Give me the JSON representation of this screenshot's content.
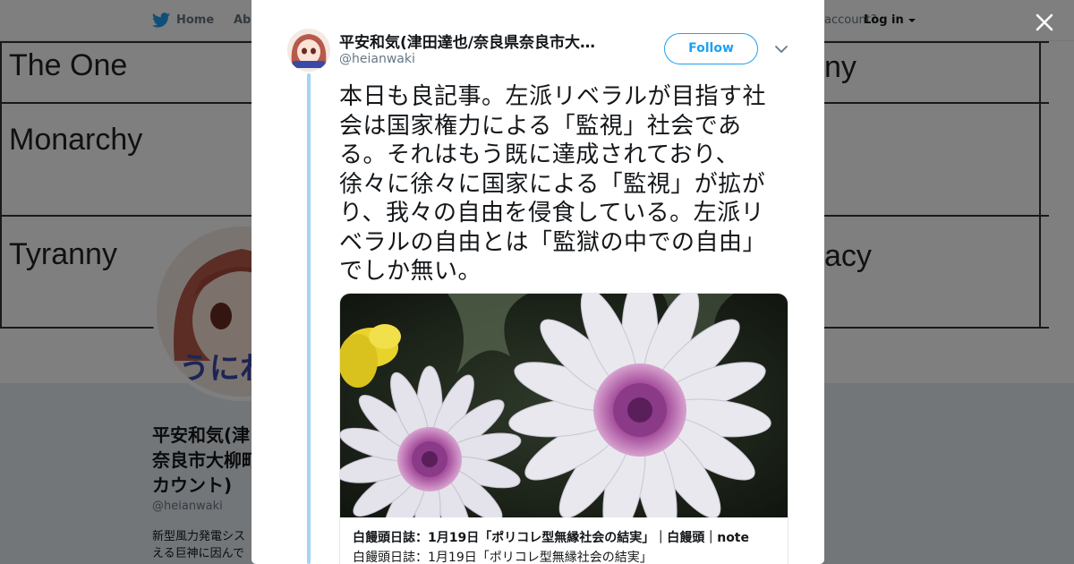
{
  "nav": {
    "home_label": "Home",
    "about_label": "Abo",
    "account_prompt": "account?",
    "login_label": "Log in"
  },
  "banner": {
    "cells": [
      "The One",
      "Monarchy",
      "Tyranny",
      "ny",
      "acy"
    ]
  },
  "profile": {
    "name": "平安和気(津田達也/奈良県奈良市大柳町カウント)",
    "name_lines": [
      "平安和気(津",
      "奈良市大柳町",
      "カウント)"
    ],
    "handle": "@heianwaki",
    "bio_lines": [
      "新型風力発電シス",
      "える巨神に因んで"
    ]
  },
  "tweet": {
    "display_name": "平安和気(津田達也/奈良県奈良市大…",
    "handle": "@heianwaki",
    "follow_label": "Follow",
    "text": "本日も良記事。左派リベラルが目指す社会は国家権力による「監視」社会である。それはもう既に達成されており、徐々に徐々に国家による「監視」が拡がり、我々の自由を侵食している。左派リベラルの自由とは「監獄の中での自由」でしか無い。",
    "text_lines": [
      "本日も良記事。左派リベラルが目指す社",
      "会は国家権力による「監視」社会であ",
      "る。それはもう既に達成されており、",
      "徐々に徐々に国家による「監視」が拡が",
      "り、我々の自由を侵食している。左派リ",
      "ベラルの自由とは「監獄の中での自由」",
      "でしか無い。"
    ],
    "card": {
      "title": "白饅頭日誌：1月19日「ポリコレ型無縁社会の結実」｜白饅頭｜note",
      "description": "白饅頭日誌：1月19日「ポリコレ型無縁社会の結実」"
    }
  },
  "colors": {
    "accent": "#1da1f2",
    "thread_line": "#a2d4f4",
    "overlay": "rgba(0,0,0,0.5)"
  },
  "icons": [
    "twitter-bird-icon",
    "close-icon",
    "chevron-down-icon",
    "caret-down-icon"
  ]
}
